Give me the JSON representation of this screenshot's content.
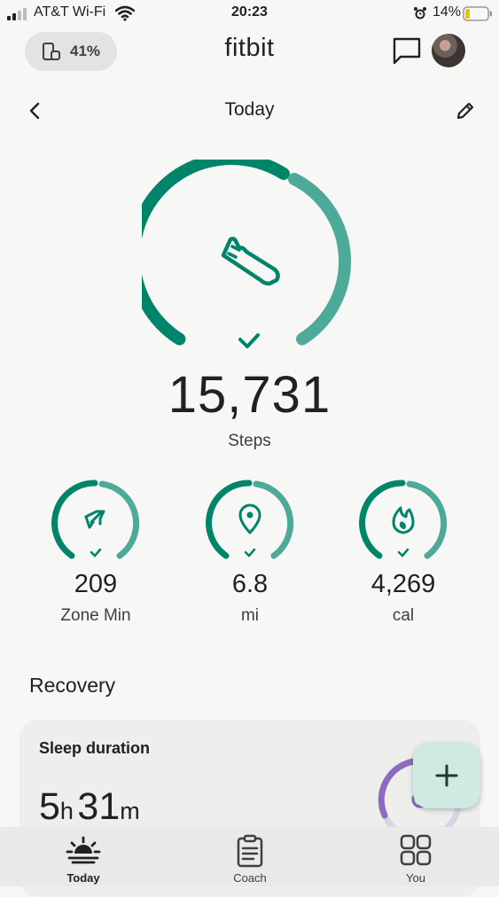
{
  "status_bar": {
    "carrier": "AT&T Wi-Fi",
    "time": "20:23",
    "battery": "14%"
  },
  "header": {
    "device_battery": "41%",
    "app_title": "fitbit"
  },
  "subheader": {
    "title": "Today"
  },
  "steps": {
    "value": "15,731",
    "label": "Steps",
    "goal_met": true,
    "ring_color": "#00846a"
  },
  "metrics": [
    {
      "value": "209",
      "label": "Zone Min",
      "icon": "zone-minutes-icon"
    },
    {
      "value": "6.8",
      "label": "mi",
      "icon": "location-pin-icon"
    },
    {
      "value": "4,269",
      "label": "cal",
      "icon": "flame-icon"
    }
  ],
  "recovery": {
    "section_title": "Recovery",
    "sleep_card": {
      "title": "Sleep duration",
      "hours": "5",
      "hours_unit": "h",
      "minutes": "31",
      "minutes_unit": "m",
      "ring_color": "#8e6bbf"
    }
  },
  "bottom_nav": [
    {
      "label": "Today",
      "icon": "today-sunrise-icon",
      "active": true
    },
    {
      "label": "Coach",
      "icon": "clipboard-icon",
      "active": false
    },
    {
      "label": "You",
      "icon": "grid-icon",
      "active": false
    }
  ],
  "colors": {
    "accent_dark": "#00846a",
    "accent_light": "#4eaa98",
    "background": "#f7f7f5"
  }
}
